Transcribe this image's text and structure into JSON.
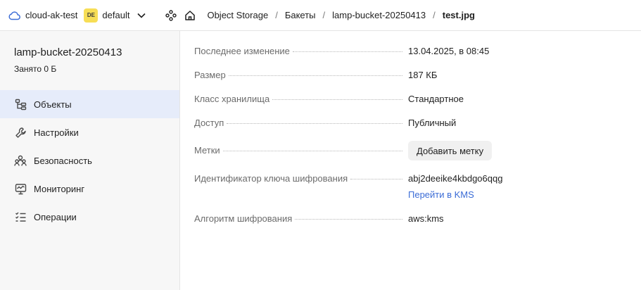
{
  "header": {
    "cloud_name": "cloud-ak-test",
    "folder_badge": "DE",
    "folder_name": "default",
    "breadcrumbs": [
      "Object Storage",
      "Бакеты",
      "lamp-bucket-20250413",
      "test.jpg"
    ],
    "separator": "/"
  },
  "sidebar": {
    "bucket_title": "lamp-bucket-20250413",
    "used": "Занято 0 Б",
    "items": [
      {
        "label": "Объекты",
        "icon": "objects-icon"
      },
      {
        "label": "Настройки",
        "icon": "wrench-icon"
      },
      {
        "label": "Безопасность",
        "icon": "users-icon"
      },
      {
        "label": "Мониторинг",
        "icon": "monitor-icon"
      },
      {
        "label": "Операции",
        "icon": "list-icon"
      }
    ]
  },
  "details": {
    "modified_label": "Последнее изменение",
    "modified_value": "13.04.2025, в 08:45",
    "size_label": "Размер",
    "size_value": "187 КБ",
    "class_label": "Класс хранилища",
    "class_value": "Стандартное",
    "access_label": "Доступ",
    "access_value": "Публичный",
    "tags_label": "Метки",
    "add_tag_button": "Добавить метку",
    "key_label": "Идентификатор ключа шифрования",
    "key_value": "abj2deeike4kbdgo6qqg",
    "kms_link": "Перейти в KMS",
    "algo_label": "Алгоритм шифрования",
    "algo_value": "aws:kms"
  },
  "colors": {
    "accent_link": "#3b6cd6",
    "active_nav_bg": "#e6ecfa",
    "folder_badge_bg": "#f7de56",
    "cloud_icon": "#3b6cd6"
  }
}
